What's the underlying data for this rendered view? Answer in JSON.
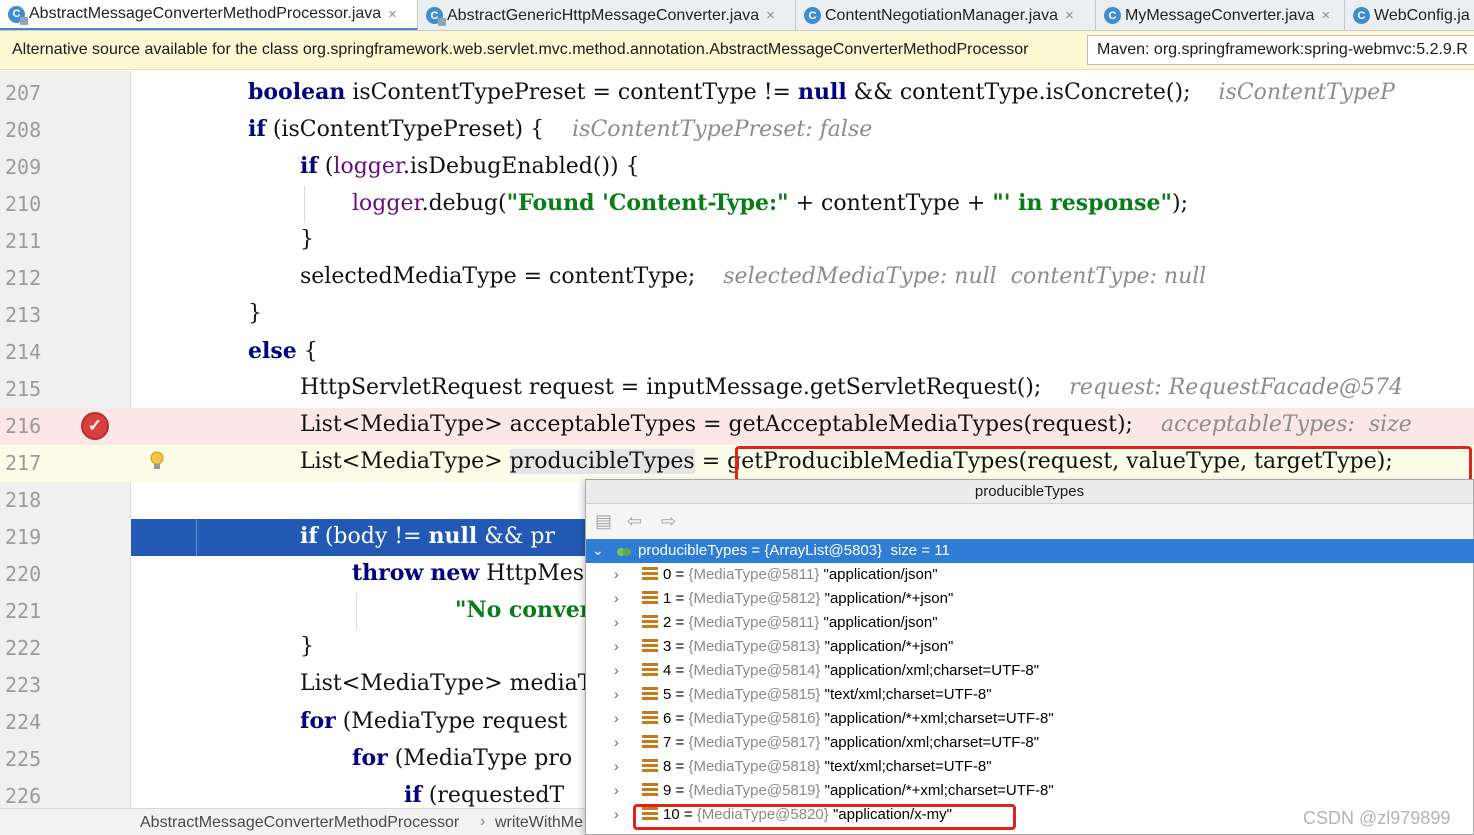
{
  "tabs": [
    {
      "label": "AbstractMessageConverterMethodProcessor.java",
      "icon": "abstract-class-icon",
      "active": true,
      "close": "×"
    },
    {
      "label": "AbstractGenericHttpMessageConverter.java",
      "icon": "abstract-class-icon",
      "close": "×"
    },
    {
      "label": "ContentNegotiationManager.java",
      "icon": "class-icon",
      "close": "×"
    },
    {
      "label": "MyMessageConverter.java",
      "icon": "class-icon",
      "close": "×"
    },
    {
      "label": "WebConfig.ja",
      "icon": "class-icon",
      "close": ""
    }
  ],
  "tab_icon_letter": "C",
  "notification": {
    "text": "Alternative source available for the class org.springframework.web.servlet.mvc.method.annotation.AbstractMessageConverterMethodProcessor",
    "selector": "Maven: org.springframework:spring-webmvc:5.2.9.R"
  },
  "code_lines": {
    "n207": "207",
    "n208": "208",
    "n209": "209",
    "n210": "210",
    "n211": "211",
    "n212": "212",
    "n213": "213",
    "n214": "214",
    "n215": "215",
    "n216": "216",
    "n217": "217",
    "n218": "218",
    "n219": "219",
    "n220": "220",
    "n221": "221",
    "n222": "222",
    "n223": "223",
    "n224": "224",
    "n225": "225",
    "n226": "226"
  },
  "code": {
    "l207_kw": "boolean",
    "l207_a": " isContentTypePreset = contentType != ",
    "l207_null": "null",
    "l207_b": " && contentType.isConcrete();",
    "l207_hint": "isContentTypeP",
    "l208_kw": "if",
    "l208_a": " (isContentTypePreset) {",
    "l208_hint": "isContentTypePreset: false",
    "l209_kw": "if",
    "l209_a": " (",
    "l209_fld": "logger",
    "l209_b": ".isDebugEnabled()) {",
    "l210_fld": "logger",
    "l210_a": ".debug(",
    "l210_str1": "\"Found 'Content-Type:\"",
    "l210_b": " + contentType + ",
    "l210_str2": "\"' in response\"",
    "l210_c": ");",
    "l211": "}",
    "l212_a": "selectedMediaType = contentType;",
    "l212_hint": "selectedMediaType: null  contentType: null",
    "l213": "}",
    "l214_kw": "else",
    "l214_a": " {",
    "l215_a": "HttpServletRequest request = inputMessage.getServletRequest();",
    "l215_hint": "request: RequestFacade@574",
    "l216_a": "List<MediaType> acceptableTypes = getAcceptableMediaTypes(request);",
    "l216_hint": "acceptableTypes:  size",
    "l217_a": "List<MediaType> ",
    "l217_sel": "producibleTypes",
    "l217_b": " = getProducibleMediaTypes(request, valueType, targetType);",
    "l219_kw": "if",
    "l219_a": " (body != ",
    "l219_null": "null",
    "l219_b": " && pr",
    "l220_kw1": "throw",
    "l220_kw2": "new",
    "l220_a": " HttpMes",
    "l221_str": "\"No conver",
    "l222": "}",
    "l223_a": "List<MediaType> mediaT",
    "l224_kw": "for",
    "l224_a": " (MediaType request",
    "l225_kw": "for",
    "l225_a": " (MediaType pro",
    "l226_kw": "if",
    "l226_a": " (requestedT"
  },
  "popup": {
    "title": "producibleTypes",
    "root": "producibleTypes = {ArrayList@5803}  size = 11",
    "items": [
      {
        "idx": "0",
        "ref": "{MediaType@5811}",
        "value": "\"application/json\""
      },
      {
        "idx": "1",
        "ref": "{MediaType@5812}",
        "value": "\"application/*+json\""
      },
      {
        "idx": "2",
        "ref": "{MediaType@5811}",
        "value": "\"application/json\""
      },
      {
        "idx": "3",
        "ref": "{MediaType@5813}",
        "value": "\"application/*+json\""
      },
      {
        "idx": "4",
        "ref": "{MediaType@5814}",
        "value": "\"application/xml;charset=UTF-8\""
      },
      {
        "idx": "5",
        "ref": "{MediaType@5815}",
        "value": "\"text/xml;charset=UTF-8\""
      },
      {
        "idx": "6",
        "ref": "{MediaType@5816}",
        "value": "\"application/*+xml;charset=UTF-8\""
      },
      {
        "idx": "7",
        "ref": "{MediaType@5817}",
        "value": "\"application/xml;charset=UTF-8\""
      },
      {
        "idx": "8",
        "ref": "{MediaType@5818}",
        "value": "\"text/xml;charset=UTF-8\""
      },
      {
        "idx": "9",
        "ref": "{MediaType@5819}",
        "value": "\"application/*+xml;charset=UTF-8\""
      },
      {
        "idx": "10",
        "ref": "{MediaType@5820}",
        "value": "\"application/x-my\""
      }
    ]
  },
  "breadcrumb": [
    "AbstractMessageConverterMethodProcessor",
    "writeWithMe"
  ],
  "watermark": "CSDN @zl979899",
  "colors": {
    "highlight_box": "#e0231b",
    "execution_line": "#2259b4",
    "selected_row": "#2f7dd4"
  }
}
